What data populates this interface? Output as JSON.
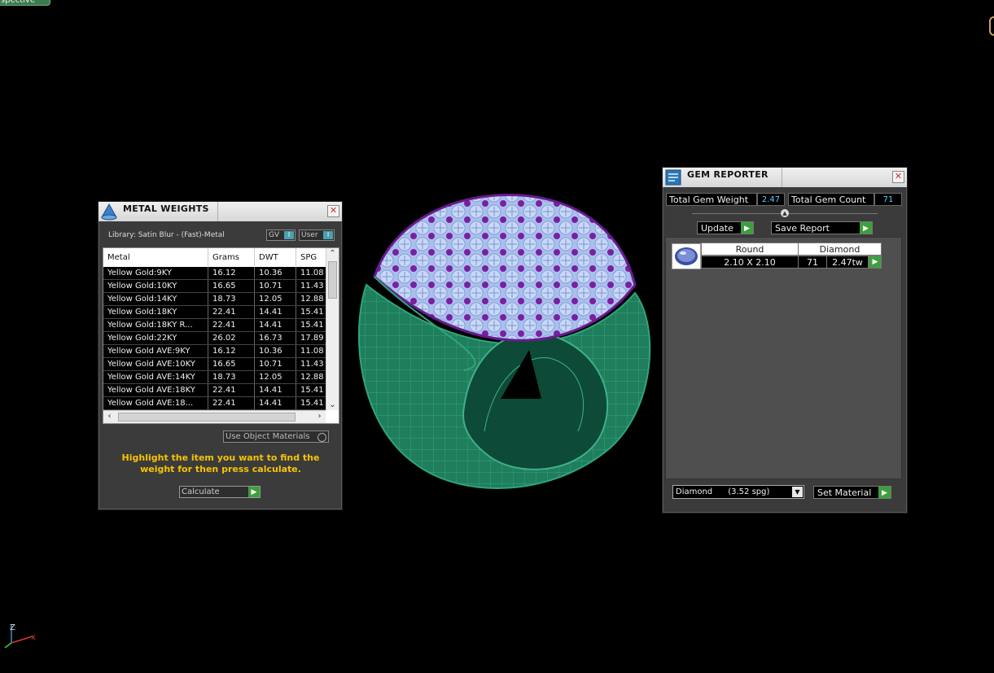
{
  "viewport": {
    "tab_label": "spective"
  },
  "metal_weights": {
    "title": "METAL WEIGHTS",
    "library_label": "Library: Satin Blur - (Fast)-Metal",
    "toggle_gv": "GV",
    "toggle_user": "User",
    "toggle_glyph": "I",
    "columns": [
      "Metal",
      "Grams",
      "DWT",
      "SPG"
    ],
    "rows": [
      {
        "metal": "Yellow Gold:9KY",
        "grams": "16.12",
        "dwt": "10.36",
        "spg": "11.08"
      },
      {
        "metal": "Yellow Gold:10KY",
        "grams": "16.65",
        "dwt": "10.71",
        "spg": "11.43"
      },
      {
        "metal": "Yellow Gold:14KY",
        "grams": "18.73",
        "dwt": "12.05",
        "spg": "12.88"
      },
      {
        "metal": "Yellow Gold:18KY",
        "grams": "22.41",
        "dwt": "14.41",
        "spg": "15.41"
      },
      {
        "metal": "Yellow Gold:18KY R...",
        "grams": "22.41",
        "dwt": "14.41",
        "spg": "15.41"
      },
      {
        "metal": "Yellow Gold:22KY",
        "grams": "26.02",
        "dwt": "16.73",
        "spg": "17.89"
      },
      {
        "metal": "Yellow Gold AVE:9KY",
        "grams": "16.12",
        "dwt": "10.36",
        "spg": "11.08"
      },
      {
        "metal": "Yellow Gold AVE:10KY",
        "grams": "16.65",
        "dwt": "10.71",
        "spg": "11.43"
      },
      {
        "metal": "Yellow Gold AVE:14KY",
        "grams": "18.73",
        "dwt": "12.05",
        "spg": "12.88"
      },
      {
        "metal": "Yellow Gold AVE:18KY",
        "grams": "22.41",
        "dwt": "14.41",
        "spg": "15.41"
      },
      {
        "metal": "Yellow Gold AVE:18...",
        "grams": "22.41",
        "dwt": "14.41",
        "spg": "15.41"
      }
    ],
    "use_object_materials": "Use Object Materials",
    "hint": "Highlight the item you want to find the weight for then press calculate.",
    "calculate_label": "Calculate",
    "close_glyph": "✕"
  },
  "gem_reporter": {
    "title": "GEM REPORTER",
    "total_gem_weight_label": "Total Gem Weight",
    "total_gem_weight_value": "2.47",
    "total_gem_count_label": "Total Gem Count",
    "total_gem_count_value": "71",
    "update_label": "Update",
    "save_report_label": "Save Report",
    "gem_header": {
      "shape": "Round",
      "material": "Diamond"
    },
    "gem_row": {
      "size": "2.10 X 2.10",
      "count": "71",
      "weight": "2.47tw"
    },
    "material_select": "Diamond      (3.52 spg)",
    "set_material_label": "Set Material",
    "close_glyph": "✕"
  },
  "axis": {
    "z": "Z",
    "x": "x"
  },
  "colors": {
    "ring": "#1e7a5a",
    "gem": "#b8c8f0",
    "prong": "#7a22a0",
    "hint": "#f5c400",
    "accent_green": "#3da03d"
  }
}
